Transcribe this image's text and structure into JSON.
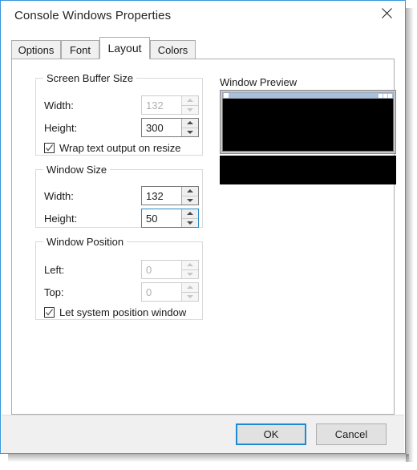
{
  "window": {
    "title": "Console Windows Properties",
    "close_icon": "close-icon",
    "border_color": "#3a96dd"
  },
  "tabs": [
    {
      "label": "Options",
      "selected": false
    },
    {
      "label": "Font",
      "selected": false
    },
    {
      "label": "Layout",
      "selected": true
    },
    {
      "label": "Colors",
      "selected": false
    }
  ],
  "groups": {
    "screen_buffer_size": {
      "label": "Screen Buffer Size",
      "fields": [
        {
          "label": "Width:",
          "value": "132",
          "disabled": true,
          "focused": false
        },
        {
          "label": "Height:",
          "value": "300",
          "disabled": false,
          "focused": false
        }
      ],
      "checkbox": {
        "label": "Wrap text output on resize",
        "checked": true
      }
    },
    "window_size": {
      "label": "Window Size",
      "fields": [
        {
          "label": "Width:",
          "value": "132",
          "disabled": false,
          "focused": false
        },
        {
          "label": "Height:",
          "value": "50",
          "disabled": false,
          "focused": true
        }
      ]
    },
    "window_position": {
      "label": "Window Position",
      "fields": [
        {
          "label": "Left:",
          "value": "0",
          "disabled": true,
          "focused": false
        },
        {
          "label": "Top:",
          "value": "0",
          "disabled": true,
          "focused": false
        }
      ],
      "checkbox": {
        "label": "Let system position window",
        "checked": true
      }
    }
  },
  "preview": {
    "title": "Window Preview",
    "client_color": "#000000",
    "titlebar_color": "#a8c0dc"
  },
  "footer": {
    "ok_label": "OK",
    "cancel_label": "Cancel",
    "accent_color": "#1f8ad2"
  }
}
